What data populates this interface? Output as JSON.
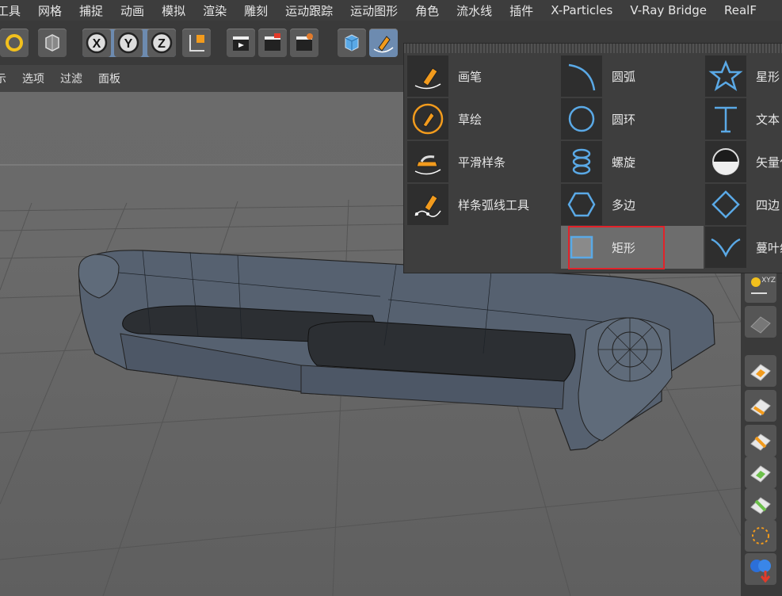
{
  "menubar": {
    "items": [
      "工具",
      "网格",
      "捕捉",
      "动画",
      "模拟",
      "渲染",
      "雕刻",
      "运动跟踪",
      "运动图形",
      "角色",
      "流水线",
      "插件",
      "X-Particles",
      "V-Ray Bridge",
      "RealF"
    ]
  },
  "viewport_menu": {
    "items": [
      "示",
      "选项",
      "过滤",
      "面板"
    ]
  },
  "toolbar": {
    "axis_x": "X",
    "axis_y": "Y",
    "axis_z": "Z"
  },
  "spline_popup": {
    "col1": [
      {
        "label": "画笔",
        "icon": "pen-icon"
      },
      {
        "label": "草绘",
        "icon": "sketch-icon"
      },
      {
        "label": "平滑样条",
        "icon": "smooth-spline-icon"
      },
      {
        "label": "样条弧线工具",
        "icon": "spline-arc-tool-icon"
      }
    ],
    "col2": [
      {
        "label": "圆弧",
        "icon": "arc-icon"
      },
      {
        "label": "圆环",
        "icon": "circle-icon"
      },
      {
        "label": "螺旋",
        "icon": "helix-icon"
      },
      {
        "label": "多边",
        "icon": "polygon-icon"
      },
      {
        "label": "矩形",
        "icon": "rectangle-icon",
        "selected": true
      }
    ],
    "col3": [
      {
        "label": "星形",
        "icon": "star-icon"
      },
      {
        "label": "文本",
        "icon": "text-icon"
      },
      {
        "label": "矢量化",
        "icon": "vectorizer-icon"
      },
      {
        "label": "四边",
        "icon": "four-sided-icon"
      },
      {
        "label": "蔓叶线",
        "icon": "cissoid-icon"
      }
    ]
  },
  "colors": {
    "accent_blue": "#5aa9e6",
    "highlight_red": "#e2232a",
    "icon_orange": "#f29b1d"
  },
  "right_strip": {
    "coord_label": "XYZ"
  }
}
